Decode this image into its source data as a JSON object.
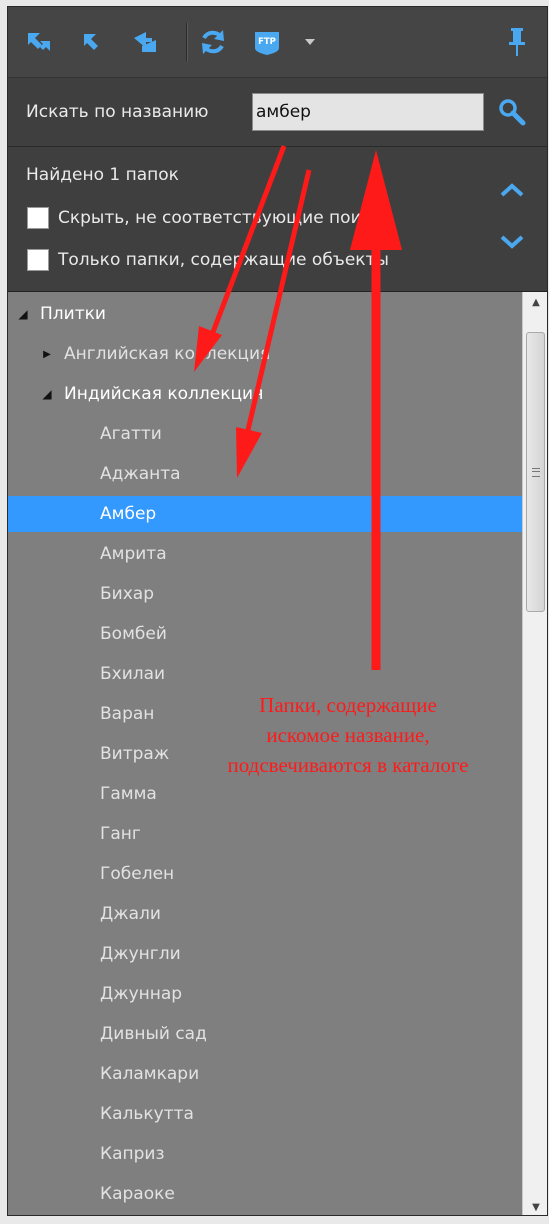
{
  "toolbar": {
    "buttons": [
      {
        "icon": "expand-all-icon"
      },
      {
        "icon": "collapse-icon"
      },
      {
        "icon": "sync-tree-icon"
      },
      {
        "icon": "refresh-icon"
      },
      {
        "icon": "ftp-icon",
        "label": "FTP"
      },
      {
        "icon": "dropdown-arrow-icon"
      },
      {
        "icon": "pin-icon"
      }
    ],
    "icon_color": "#4aa8f0"
  },
  "search": {
    "label": "Искать по названию",
    "value": "амбер"
  },
  "info": {
    "found_text": "Найдено 1 папок",
    "options": [
      {
        "label": "Скрыть, не соответствующие поиску",
        "checked": false
      },
      {
        "label": "Только папки, содержащие объекты",
        "checked": false
      }
    ]
  },
  "tree": {
    "items": [
      {
        "label": "Плитки",
        "level": 0,
        "expander": "open"
      },
      {
        "label": "Английская коллекция",
        "level": 1,
        "expander": "closed"
      },
      {
        "label": "Индийская коллекция",
        "level": 1,
        "expander": "open"
      },
      {
        "label": "Агатти",
        "level": 2
      },
      {
        "label": "Аджанта",
        "level": 2
      },
      {
        "label": "Амбер",
        "level": 2,
        "selected": true
      },
      {
        "label": "Амрита",
        "level": 2
      },
      {
        "label": "Бихар",
        "level": 2
      },
      {
        "label": "Бомбей",
        "level": 2
      },
      {
        "label": "Бхилаи",
        "level": 2
      },
      {
        "label": "Варан",
        "level": 2
      },
      {
        "label": "Витраж",
        "level": 2
      },
      {
        "label": "Гамма",
        "level": 2
      },
      {
        "label": "Ганг",
        "level": 2
      },
      {
        "label": "Гобелен",
        "level": 2
      },
      {
        "label": "Джали",
        "level": 2
      },
      {
        "label": "Джунгли",
        "level": 2
      },
      {
        "label": "Джуннар",
        "level": 2
      },
      {
        "label": "Дивный сад",
        "level": 2
      },
      {
        "label": "Каламкари",
        "level": 2
      },
      {
        "label": "Калькутта",
        "level": 2
      },
      {
        "label": "Каприз",
        "level": 2
      },
      {
        "label": "Караоке",
        "level": 2
      }
    ],
    "selection_color": "#3399ff"
  },
  "annotation": {
    "lines": [
      "Папки, содержащие",
      "искомое название,",
      "подсвечиваются в каталоге"
    ],
    "color": "#ff1a1a"
  }
}
